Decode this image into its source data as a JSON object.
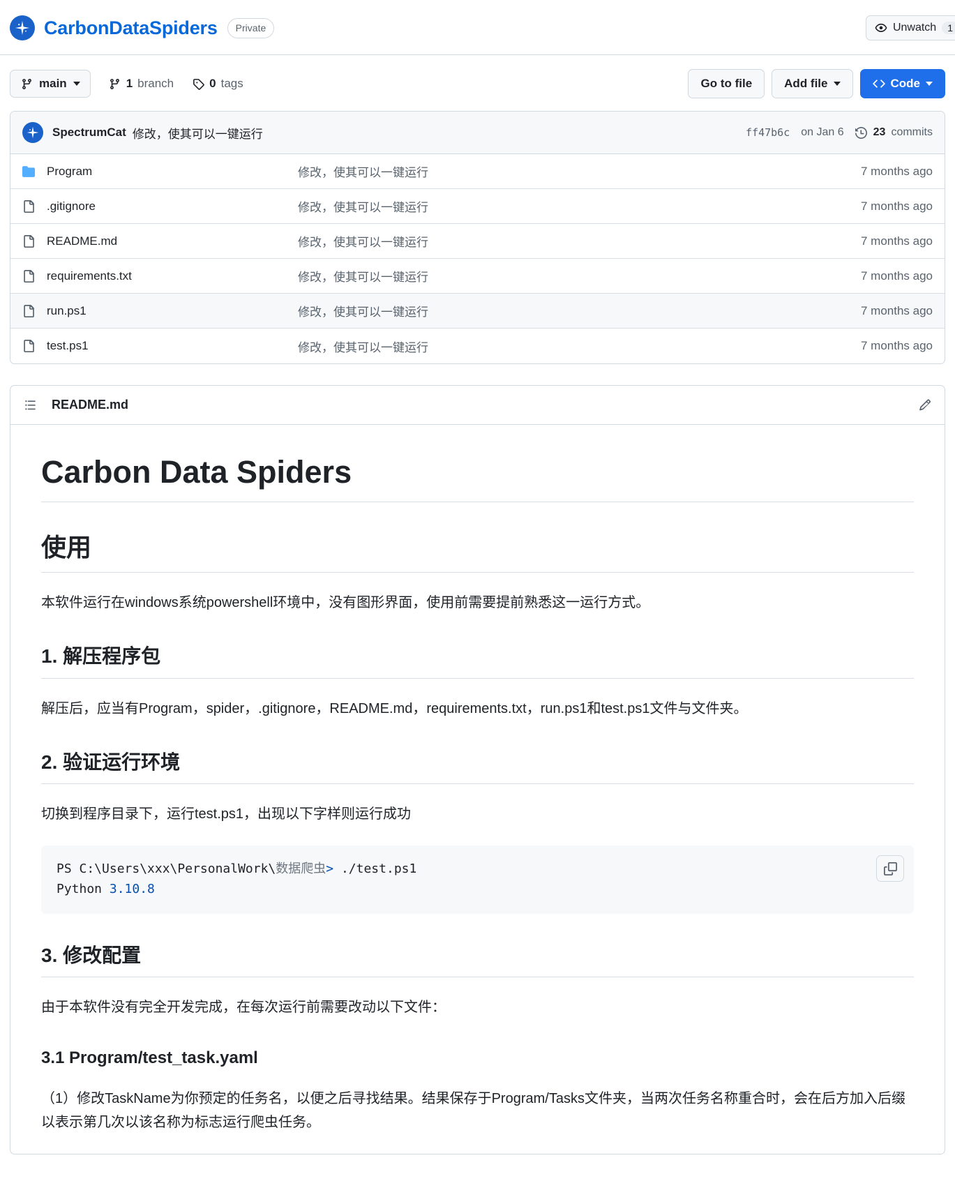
{
  "repo": {
    "name": "CarbonDataSpiders",
    "visibility": "Private",
    "avatar_icon": "sparkle-avatar-icon",
    "accent_color": "#0969da",
    "avatar_color": "#1a62c9"
  },
  "header_actions": {
    "watch_label": "Unwatch",
    "watch_count": "1",
    "eye_icon": "eye-icon"
  },
  "toolbar": {
    "branch": "main",
    "branch_icon": "branch-icon",
    "branches_count": "1",
    "branches_label": "branch",
    "tags_count": "0",
    "tags_label": "tags",
    "tag_icon": "tag-icon",
    "go_to_file": "Go to file",
    "add_file": "Add file",
    "code": "Code",
    "code_icon": "code-brackets-icon"
  },
  "commit": {
    "author": "SpectrumCat",
    "message": "修改，使其可以一键运行",
    "sha": "ff47b6c",
    "date": "on Jan 6",
    "commits_count": "23",
    "commits_label": "commits",
    "history_icon": "history-clock-icon"
  },
  "files": [
    {
      "name": "Program",
      "type": "folder",
      "message": "修改，使其可以一键运行",
      "time": "7 months ago",
      "highlight": false
    },
    {
      "name": ".gitignore",
      "type": "file",
      "message": "修改，使其可以一键运行",
      "time": "7 months ago",
      "highlight": false
    },
    {
      "name": "README.md",
      "type": "file",
      "message": "修改，使其可以一键运行",
      "time": "7 months ago",
      "highlight": false
    },
    {
      "name": "requirements.txt",
      "type": "file",
      "message": "修改，使其可以一键运行",
      "time": "7 months ago",
      "highlight": false
    },
    {
      "name": "run.ps1",
      "type": "file",
      "message": "修改，使其可以一键运行",
      "time": "7 months ago",
      "highlight": true
    },
    {
      "name": "test.ps1",
      "type": "file",
      "message": "修改，使其可以一键运行",
      "time": "7 months ago",
      "highlight": false
    }
  ],
  "readme": {
    "filename": "README.md",
    "outline_icon": "list-unordered-icon",
    "edit_icon": "pencil-icon",
    "h1": "Carbon Data Spiders",
    "h2_usage": "使用",
    "p_intro": "本软件运行在windows系统powershell环境中，没有图形界面，使用前需要提前熟悉这一运行方式。",
    "h3_step1": "1. 解压程序包",
    "p_step1": "解压后，应当有Program，spider，.gitignore，README.md，requirements.txt，run.ps1和test.ps1文件与文件夹。",
    "h3_step2": "2. 验证运行环境",
    "p_step2": "切换到程序目录下，运行test.ps1，出现以下字样则运行成功",
    "code": {
      "line1_prefix": "PS C:\\Users\\xxx\\PersonalWork\\",
      "line1_dim": "数据爬虫",
      "line1_op": ">",
      "line1_suffix": " ./test.ps1",
      "line2_prefix": "Python ",
      "line2_num": "3.10.8",
      "copy_icon": "copy-icon"
    },
    "h3_step3": "3. 修改配置",
    "p_step3": "由于本软件没有完全开发完成，在每次运行前需要改动以下文件：",
    "h4_step31": "3.1 Program/test_task.yaml",
    "p_step31": "（1）修改TaskName为你预定的任务名，以便之后寻找结果。结果保存于Program/Tasks文件夹，当两次任务名称重合时，会在后方加入后缀以表示第几次以该名称为标志运行爬虫任务。"
  }
}
